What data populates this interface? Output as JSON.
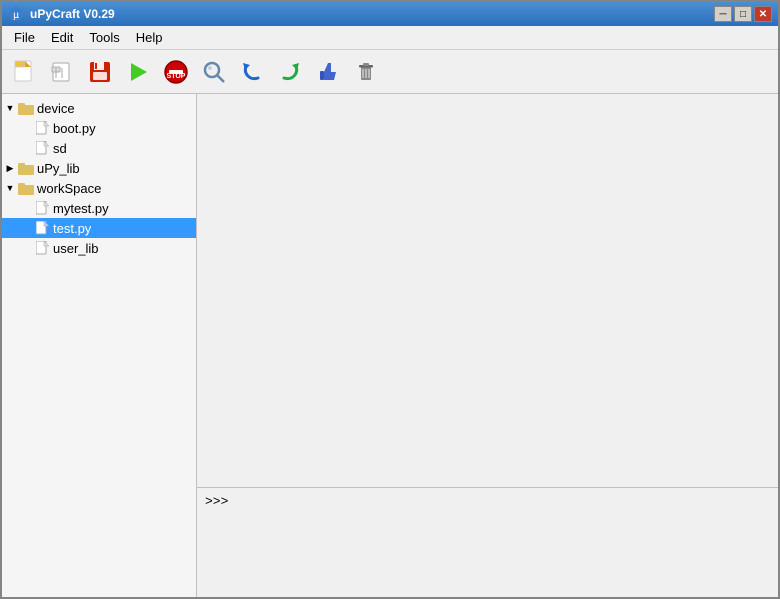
{
  "window": {
    "title": "uPyCraft V0.29",
    "title_icon": "🐍"
  },
  "title_buttons": {
    "minimize": "─",
    "maximize": "□",
    "close": "✕"
  },
  "menu": {
    "items": [
      "File",
      "Edit",
      "Tools",
      "Help"
    ]
  },
  "toolbar": {
    "buttons": [
      {
        "name": "new-file-button",
        "icon": "📄",
        "label": "New"
      },
      {
        "name": "open-button",
        "icon": "📃",
        "label": "Open"
      },
      {
        "name": "save-button",
        "icon": "💾",
        "label": "Save"
      },
      {
        "name": "run-button",
        "icon": "▶",
        "label": "Run"
      },
      {
        "name": "stop-button",
        "icon": "⛔",
        "label": "Stop"
      },
      {
        "name": "search-button",
        "icon": "🔍",
        "label": "Search"
      },
      {
        "name": "undo-button",
        "icon": "↩",
        "label": "Undo"
      },
      {
        "name": "redo-button",
        "icon": "↪",
        "label": "Redo"
      },
      {
        "name": "like-button",
        "icon": "👍",
        "label": "Like"
      },
      {
        "name": "delete-button",
        "icon": "🗑",
        "label": "Delete"
      }
    ]
  },
  "sidebar": {
    "tree": [
      {
        "id": "device",
        "label": "device",
        "type": "folder",
        "expanded": true,
        "indent": 0,
        "children": [
          {
            "id": "boot-py",
            "label": "boot.py",
            "type": "file",
            "indent": 1
          }
        ]
      },
      {
        "id": "sd",
        "label": "sd",
        "type": "file",
        "indent": 1
      },
      {
        "id": "upy-lib",
        "label": "uPy_lib",
        "type": "folder",
        "expanded": false,
        "indent": 0
      },
      {
        "id": "workspace",
        "label": "workSpace",
        "type": "folder",
        "expanded": true,
        "indent": 0,
        "children": [
          {
            "id": "mytest-py",
            "label": "mytest.py",
            "type": "file",
            "indent": 1
          },
          {
            "id": "test-py",
            "label": "test.py",
            "type": "file",
            "indent": 1,
            "selected": true
          },
          {
            "id": "user-lib",
            "label": "user_lib",
            "type": "file",
            "indent": 1
          }
        ]
      }
    ]
  },
  "console": {
    "prompt": ">>>"
  }
}
